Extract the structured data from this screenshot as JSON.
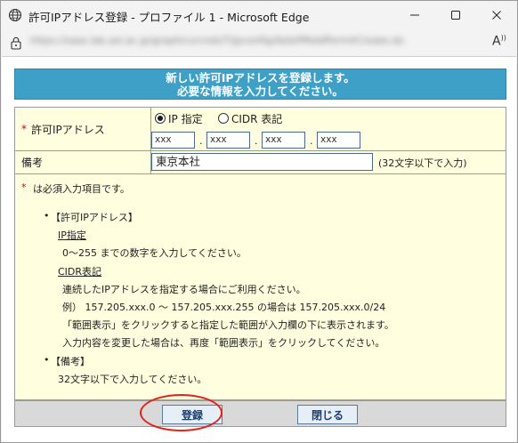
{
  "window": {
    "title": "許可IPアドレス登録 - プロファイル 1 - Microsoft Edge",
    "minimize_icon": "minimize-icon",
    "maximize_icon": "maximize-icon",
    "close_icon": "close-icon"
  },
  "addressbar": {
    "url": "https://saas.lab.asl.ac.jp/graphics/cnds/T/jpconfig/Add/IPAddPermitCreate.do",
    "read_aloud_label": "A"
  },
  "page": {
    "header_line1": "新しい許可IPアドレスを登録します。",
    "header_line2": "必要な情報を入力してください。",
    "ip_label": "許可IPアドレス",
    "required_mark": "*",
    "radio_ip": "IP 指定",
    "radio_cidr": "CIDR 表記",
    "radio_selected": "IP 指定",
    "ip_fields": [
      "xxx",
      "xxx",
      "xxx",
      "xxx"
    ],
    "ip_dot": ".",
    "memo_label": "備考",
    "memo_value": "東京本社",
    "memo_hint": "(32文字以下で入力)"
  },
  "notes": {
    "required_note_mark": "*",
    "required_note": "は必須入力項目です。",
    "ip_heading": "【許可IPアドレス】",
    "ip_sub": "IP指定",
    "ip_desc": "0～255 までの数字を入力してください。",
    "cidr_sub": "CIDR表記",
    "cidr_desc1": "連続したIPアドレスを指定する場合にご利用ください。",
    "cidr_desc2": "例） 157.205.xxx.0 ～ 157.205.xxx.255 の場合は 157.205.xxx.0/24",
    "cidr_desc3": "「範囲表示」をクリックすると指定した範囲が入力欄の下に表示されます。",
    "cidr_desc4": "入力内容を変更した場合は、再度「範囲表示」をクリックしてください。",
    "memo_heading": "【備考】",
    "memo_desc": "32文字以下で入力してください。",
    "bullet": "•"
  },
  "footer": {
    "register_label": "登録",
    "close_label": "閉じる"
  },
  "colors": {
    "header_bg": "#3fa0c7",
    "form_bg": "#ffffe0",
    "required": "#d00000",
    "highlight_circle": "#e0241c"
  }
}
